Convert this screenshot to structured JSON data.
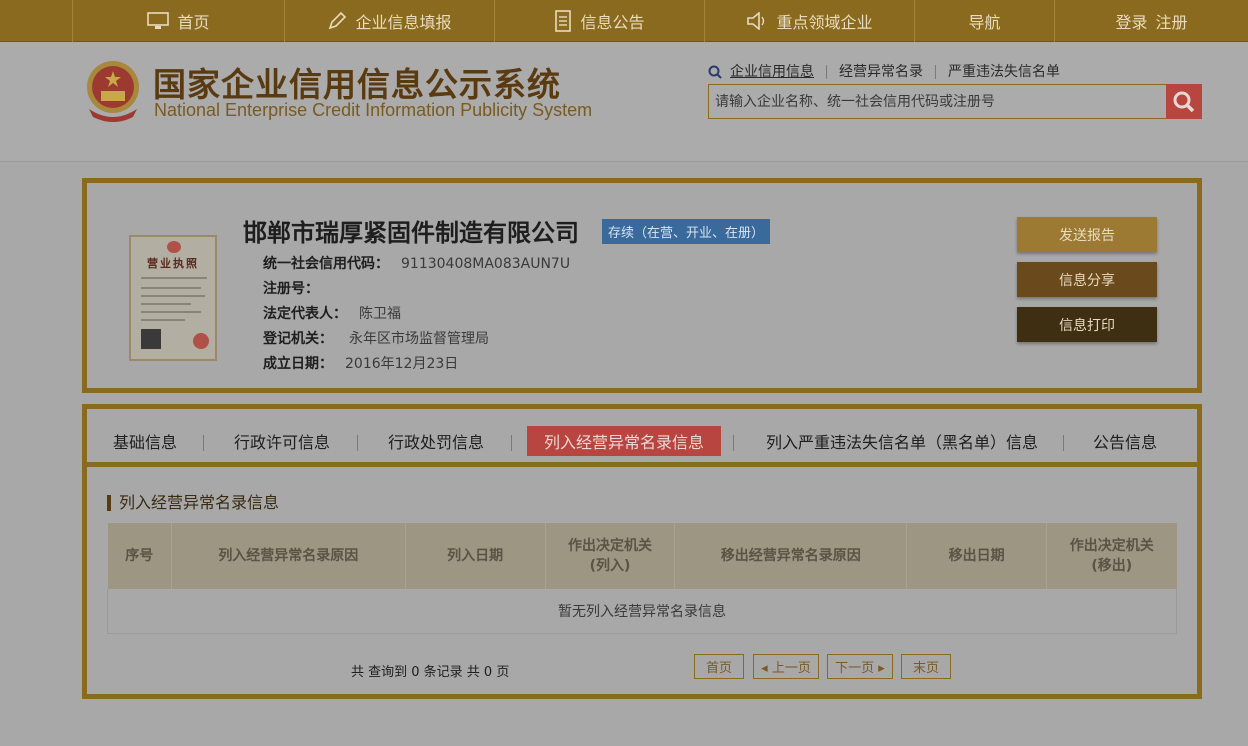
{
  "nav": {
    "home": "首页",
    "report": "企业信息填报",
    "notice": "信息公告",
    "key_fields": "重点领域企业",
    "navigation": "导航",
    "login": "登录",
    "register": "注册"
  },
  "header": {
    "title_cn": "国家企业信用信息公示系统",
    "title_en": "National Enterprise Credit Information Publicity System",
    "search_links": [
      "企业信用信息",
      "经营异常名录",
      "严重违法失信名单"
    ],
    "search_placeholder": "请输入企业名称、统一社会信用代码或注册号"
  },
  "company": {
    "license_title": "营业执照",
    "name": "邯郸市瑞厚紧固件制造有限公司",
    "status": "存续（在营、开业、在册）",
    "fields": [
      {
        "label": "统一社会信用代码：",
        "value": "91130408MA083AUN7U"
      },
      {
        "label": "注册号：",
        "value": ""
      },
      {
        "label": "法定代表人：",
        "value": "陈卫福"
      },
      {
        "label": "登记机关：",
        "value": "永年区市场监督管理局"
      },
      {
        "label": "成立日期：",
        "value": "2016年12月23日"
      }
    ],
    "actions": {
      "send_report": "发送报告",
      "share": "信息分享",
      "print": "信息打印"
    }
  },
  "tabs": [
    "基础信息",
    "行政许可信息",
    "行政处罚信息",
    "列入经营异常名录信息",
    "列入严重违法失信名单（黑名单）信息",
    "公告信息"
  ],
  "section": {
    "title": "列入经营异常名录信息",
    "columns": [
      "序号",
      "列入经营异常名录原因",
      "列入日期",
      "作出决定机关\n(列入)",
      "移出经营异常名录原因",
      "移出日期",
      "作出决定机关\n(移出)"
    ],
    "empty_text": "暂无列入经营异常名录信息"
  },
  "pager": {
    "info": "共 查询到 0 条记录 共 0 页",
    "first": "首页",
    "prev": "◂ 上一页",
    "next": "下一页 ▸",
    "last": "末页"
  },
  "colors": {
    "brand_gold": "#8a6a1f",
    "active_tab": "#b8453f",
    "status_blue": "#3a6a9c"
  }
}
